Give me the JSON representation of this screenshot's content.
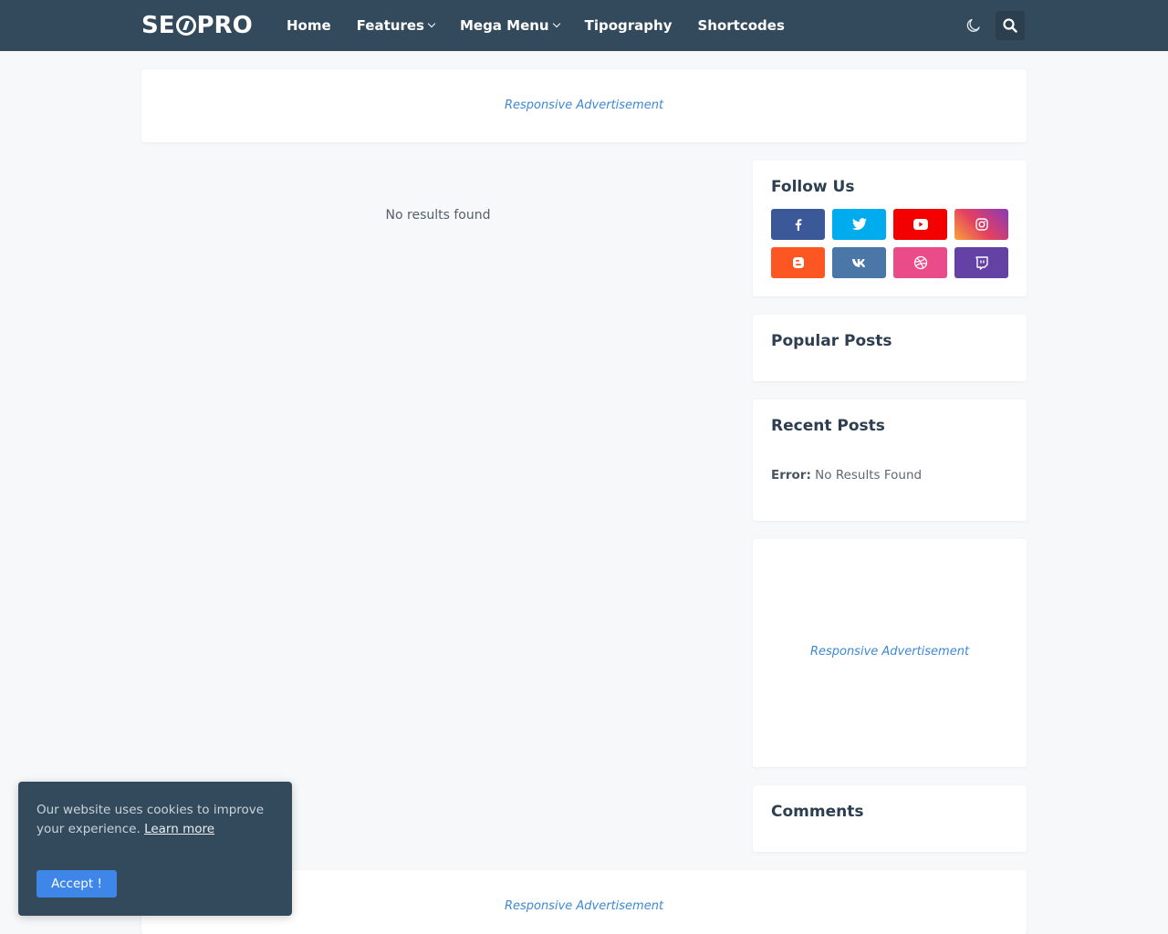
{
  "header": {
    "logo_left": "SE",
    "logo_right": "PRO",
    "nav": [
      {
        "label": "Home",
        "dropdown": false
      },
      {
        "label": "Features",
        "dropdown": true
      },
      {
        "label": "Mega Menu",
        "dropdown": true
      },
      {
        "label": "Tipography",
        "dropdown": false
      },
      {
        "label": "Shortcodes",
        "dropdown": false
      }
    ],
    "icons": [
      "moon-icon",
      "search-icon"
    ]
  },
  "top_ad": {
    "label": "Responsive Advertisement"
  },
  "main": {
    "empty_message": "No results found"
  },
  "sidebar": {
    "follow": {
      "title": "Follow Us",
      "networks": [
        {
          "name": "facebook",
          "color": "#3b5998"
        },
        {
          "name": "twitter",
          "color": "#00acee"
        },
        {
          "name": "youtube",
          "color": "#f50000"
        },
        {
          "name": "instagram",
          "color": "#c13584"
        },
        {
          "name": "blogger",
          "color": "#fc5722"
        },
        {
          "name": "vk",
          "color": "#4a76a8"
        },
        {
          "name": "dribbble",
          "color": "#ea4c89"
        },
        {
          "name": "twitch",
          "color": "#6441a5"
        }
      ]
    },
    "popular": {
      "title": "Popular Posts"
    },
    "recent": {
      "title": "Recent Posts",
      "error_label": "Error:",
      "error_text": "No Results Found"
    },
    "ad": {
      "label": "Responsive Advertisement"
    },
    "comments": {
      "title": "Comments"
    }
  },
  "bottom_ad": {
    "label": "Responsive Advertisement"
  },
  "cookie": {
    "text": "Our website uses cookies to improve your experience.",
    "link": "Learn more",
    "button": "Accept !"
  },
  "colors": {
    "header_bg": "#334a5c",
    "accent": "#3e86e8",
    "ad_text": "#3d88d1"
  }
}
